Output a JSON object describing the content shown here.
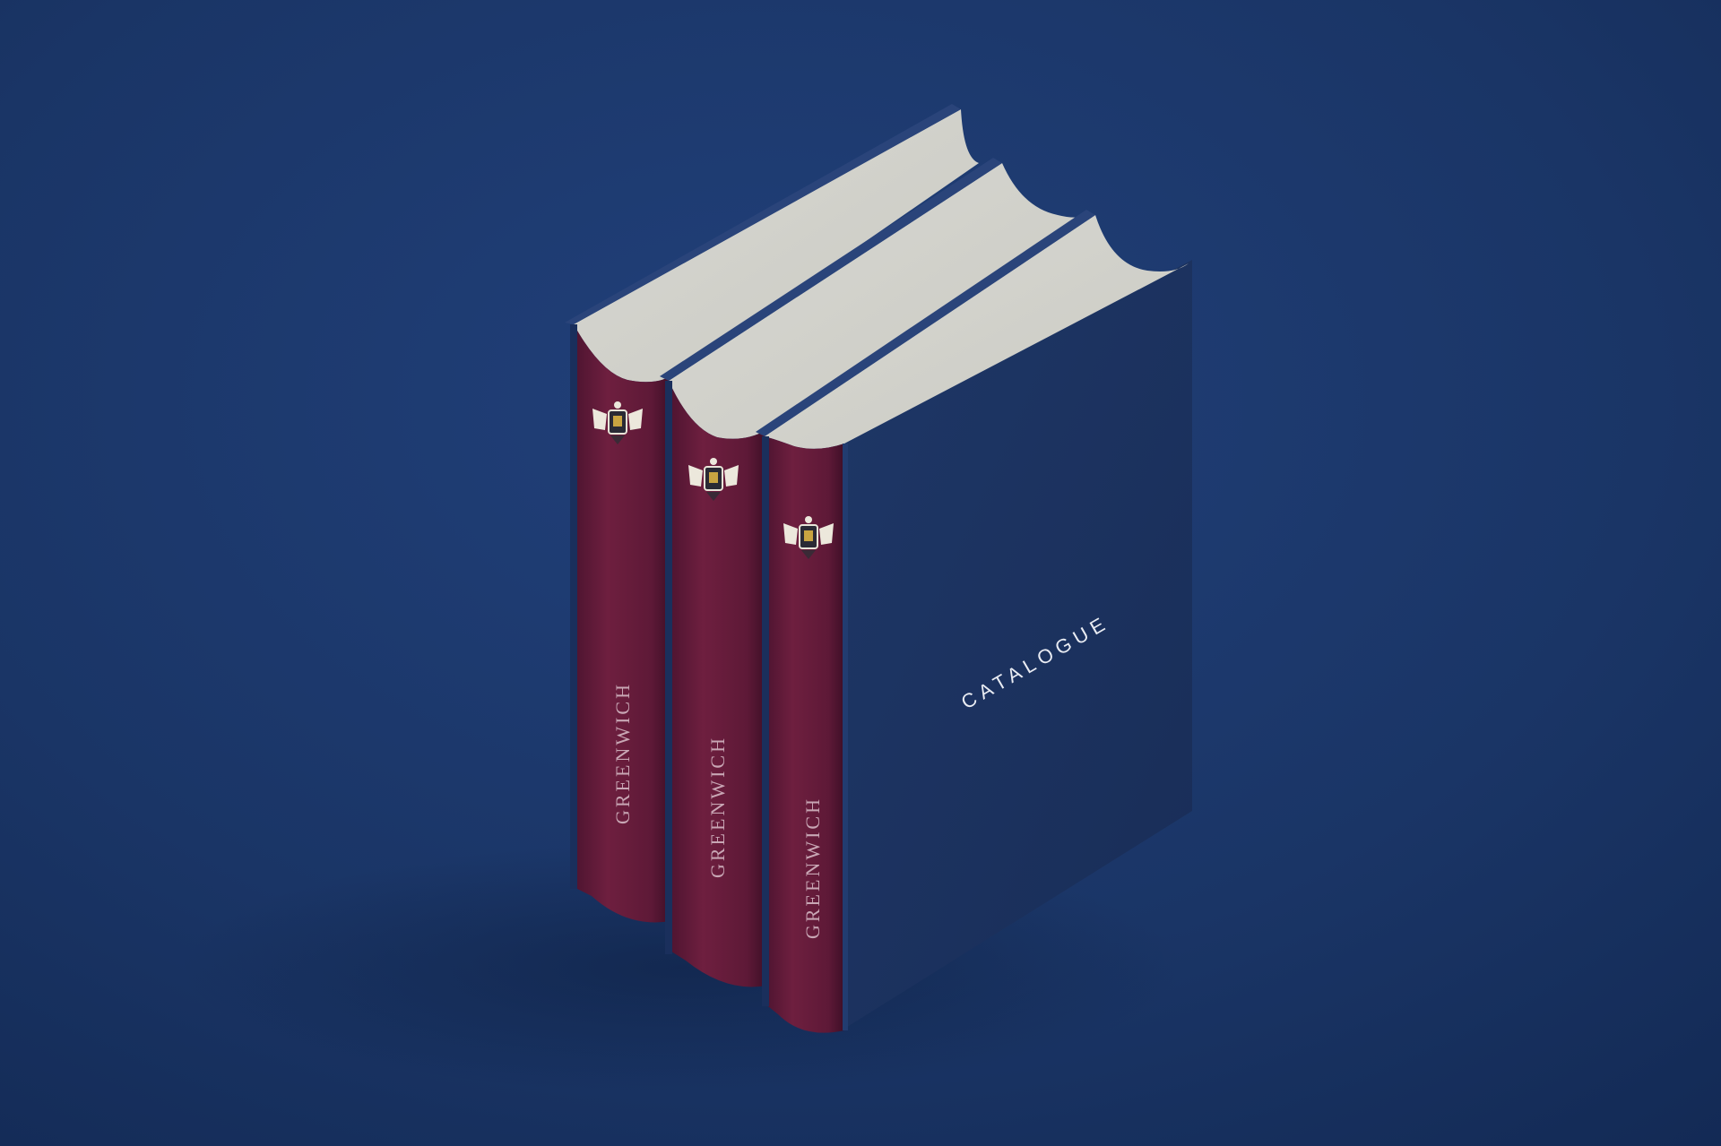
{
  "scene": {
    "description_free": true,
    "colors": {
      "background": "#1b3567",
      "cover": "#1c3260",
      "spine": "#6b1e3c",
      "pages": "#dcdcd6"
    }
  },
  "books": [
    {
      "spine_text": "GREENWICH",
      "emblem": "crest-icon"
    },
    {
      "spine_text": "GREENWICH",
      "emblem": "crest-icon"
    },
    {
      "spine_text": "GREENWICH",
      "emblem": "crest-icon"
    }
  ],
  "front_cover": {
    "title": "CATALOGUE"
  }
}
